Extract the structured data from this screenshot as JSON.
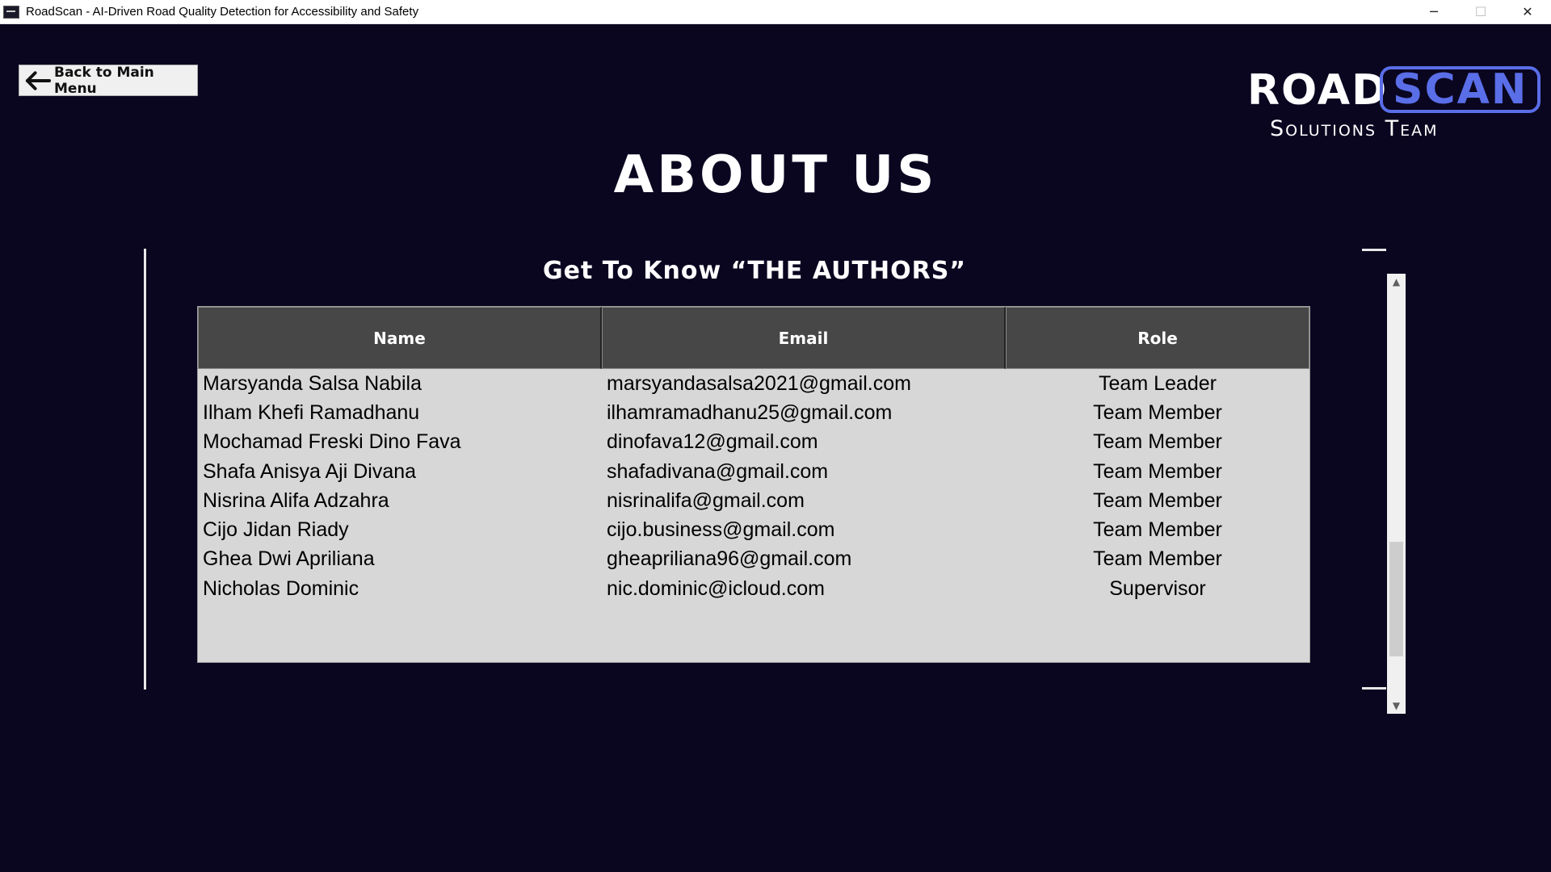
{
  "window": {
    "title": "RoadScan - AI-Driven Road Quality Detection for Accessibility and Safety",
    "minimize_glyph": "─",
    "maximize_glyph": "☐",
    "close_glyph": "✕"
  },
  "nav": {
    "back_label": "Back to Main Menu",
    "back_icon": "arrow-left-icon"
  },
  "logo": {
    "word1": "ROAD",
    "word2": "SCAN",
    "subtitle": "Solutions Team",
    "accent_color": "#5a6ee8"
  },
  "page": {
    "title": "ABOUT US",
    "subtitle": "Get To Know “THE AUTHORS”"
  },
  "table": {
    "columns": [
      "Name",
      "Email",
      "Role"
    ],
    "rows": [
      [
        "Marsyanda Salsa Nabila",
        "marsyandasalsa2021@gmail.com",
        "Team Leader"
      ],
      [
        "Ilham Khefi Ramadhanu",
        "ilhamramadhanu25@gmail.com",
        "Team Member"
      ],
      [
        "Mochamad Freski Dino Fava",
        "dinofava12@gmail.com",
        "Team Member"
      ],
      [
        "Shafa Anisya Aji Divana",
        "shafadivana@gmail.com",
        "Team Member"
      ],
      [
        "Nisrina Alifa Adzahra",
        "nisrinalifa@gmail.com",
        "Team Member"
      ],
      [
        "Cijo Jidan Riady",
        "cijo.business@gmail.com",
        "Team Member"
      ],
      [
        "Ghea Dwi Apriliana",
        "gheapriliana96@gmail.com",
        "Team Member"
      ],
      [
        "Nicholas Dominic",
        "nic.dominic@icloud.com",
        "Supervisor"
      ]
    ]
  },
  "colors": {
    "background": "#0a0620",
    "table_header": "#474747",
    "table_body": "#d7d7d7"
  }
}
